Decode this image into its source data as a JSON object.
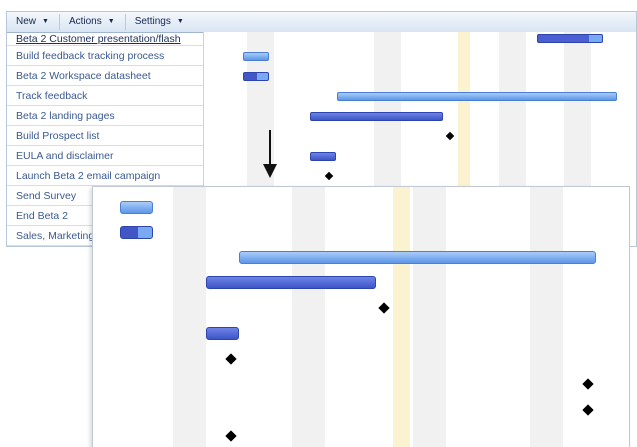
{
  "toolbar": {
    "menus": [
      {
        "label": "New"
      },
      {
        "label": "Actions"
      },
      {
        "label": "Settings"
      }
    ]
  },
  "tasks": [
    "Beta 2 Customer presentation/flash",
    "Build feedback tracking process",
    "Beta 2 Workspace datasheet",
    "Track feedback",
    "Beta 2 landing pages",
    "Build Prospect list",
    "EULA and disclaimer",
    "Launch Beta 2 email campaign",
    "Send Survey",
    "End Beta 2",
    "Sales, Marketing"
  ],
  "colors": {
    "bar_light": "#5c96e9",
    "bar_dark": "#3d56c7",
    "today_column": "#fbf2d0",
    "weekend_column": "#f1f1f1",
    "milestone": "#000000",
    "task_text": "#3a5a92"
  },
  "icons": {
    "menu_caret": "chevron-down-icon",
    "zoom_arrow": "arrow-down-icon",
    "milestone": "diamond-icon"
  }
}
